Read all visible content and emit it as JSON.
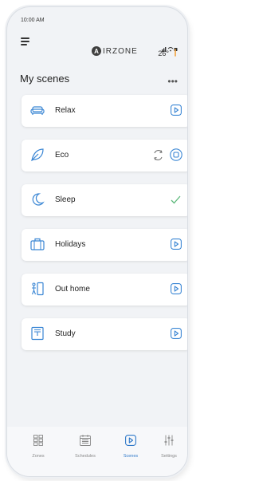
{
  "status_bar": {
    "time": "10:00 AM"
  },
  "header": {
    "brand_logo_letter": "A",
    "brand_name": "IRZONE",
    "temperature": "26°"
  },
  "page": {
    "title": "My scenes"
  },
  "scenes": [
    {
      "label": "Relax",
      "icon": "sofa-icon",
      "action": "play"
    },
    {
      "label": "Eco",
      "icon": "leaf-icon",
      "action": "active"
    },
    {
      "label": "Sleep",
      "icon": "moon-icon",
      "action": "checked"
    },
    {
      "label": "Holidays",
      "icon": "suitcase-icon",
      "action": "play"
    },
    {
      "label": "Out home",
      "icon": "door-exit-icon",
      "action": "play"
    },
    {
      "label": "Study",
      "icon": "book-icon",
      "action": "play"
    }
  ],
  "tabs": [
    {
      "label": "Zones",
      "icon": "grid-icon",
      "active": false
    },
    {
      "label": "Schedules",
      "icon": "calendar-icon",
      "active": false
    },
    {
      "label": "Scenes",
      "icon": "play-icon",
      "active": true
    },
    {
      "label": "Settings",
      "icon": "sliders-icon",
      "active": false
    }
  ],
  "colors": {
    "accent": "#2f79c9",
    "icon_blue": "#3a86d4",
    "check_green": "#5bb87a",
    "sun": "#f2a23c"
  }
}
